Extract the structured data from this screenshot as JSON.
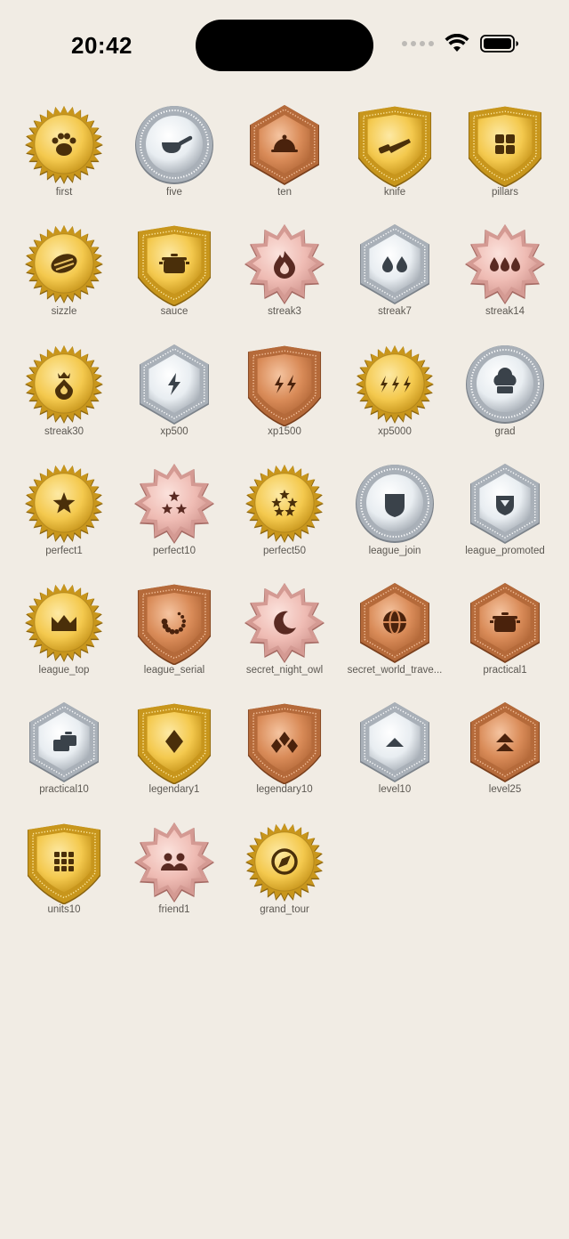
{
  "status_bar": {
    "time": "20:42",
    "icons": [
      "cellular-dots-icon",
      "wifi-icon",
      "battery-icon"
    ]
  },
  "palettes": {
    "gold": {
      "rim": "#c8961c",
      "face": "#f4c94e",
      "light": "#fde9a4",
      "dark": "#8a6410",
      "glyph": "#4a2f0a"
    },
    "silver": {
      "rim": "#a9b0b8",
      "face": "#e8edf1",
      "light": "#ffffff",
      "dark": "#7c838b",
      "glyph": "#3a424a"
    },
    "bronze": {
      "rim": "#b56a3a",
      "face": "#d98b58",
      "light": "#f5c4a0",
      "dark": "#7a3f1c",
      "glyph": "#4a220c"
    },
    "rose": {
      "rim": "#d49a93",
      "face": "#efbcb4",
      "light": "#fbe2dc",
      "dark": "#a56a63",
      "glyph": "#5a2a22"
    }
  },
  "badges": [
    {
      "label": "first",
      "shape": "sun",
      "metal": "gold",
      "icon": "paw-icon"
    },
    {
      "label": "five",
      "shape": "circle",
      "metal": "silver",
      "icon": "pan-icon"
    },
    {
      "label": "ten",
      "shape": "hexagon",
      "metal": "bronze",
      "icon": "cloche-icon"
    },
    {
      "label": "knife",
      "shape": "shield",
      "metal": "gold",
      "icon": "knife-icon"
    },
    {
      "label": "pillars",
      "shape": "shield",
      "metal": "gold",
      "icon": "grid-four-icon"
    },
    {
      "label": "sizzle",
      "shape": "sun",
      "metal": "gold",
      "icon": "sizzle-icon"
    },
    {
      "label": "sauce",
      "shape": "shield",
      "metal": "gold",
      "icon": "pot-icon"
    },
    {
      "label": "streak3",
      "shape": "star",
      "metal": "rose",
      "icon": "flame-icon"
    },
    {
      "label": "streak7",
      "shape": "hexagon",
      "metal": "silver",
      "icon": "double-drop-icon"
    },
    {
      "label": "streak14",
      "shape": "star",
      "metal": "rose",
      "icon": "triple-drop-icon"
    },
    {
      "label": "streak30",
      "shape": "sun",
      "metal": "gold",
      "icon": "crowned-flame-icon"
    },
    {
      "label": "xp500",
      "shape": "hexagon",
      "metal": "silver",
      "icon": "bolt-icon"
    },
    {
      "label": "xp1500",
      "shape": "shield",
      "metal": "bronze",
      "icon": "double-bolt-icon"
    },
    {
      "label": "xp5000",
      "shape": "sun",
      "metal": "gold",
      "icon": "triple-bolt-icon"
    },
    {
      "label": "grad",
      "shape": "circle",
      "metal": "silver",
      "icon": "chef-hat-icon"
    },
    {
      "label": "perfect1",
      "shape": "sun",
      "metal": "gold",
      "icon": "star-icon"
    },
    {
      "label": "perfect10",
      "shape": "star",
      "metal": "rose",
      "icon": "three-stars-icon"
    },
    {
      "label": "perfect50",
      "shape": "sun",
      "metal": "gold",
      "icon": "five-stars-icon"
    },
    {
      "label": "league_join",
      "shape": "circle",
      "metal": "silver",
      "icon": "shield-icon"
    },
    {
      "label": "league_promoted",
      "shape": "hexagon",
      "metal": "silver",
      "icon": "chevron-shield-icon"
    },
    {
      "label": "league_top",
      "shape": "sun",
      "metal": "gold",
      "icon": "crown-icon"
    },
    {
      "label": "league_serial",
      "shape": "shield",
      "metal": "bronze",
      "icon": "loading-ring-icon"
    },
    {
      "label": "secret_night_owl",
      "shape": "star",
      "metal": "rose",
      "icon": "moon-icon"
    },
    {
      "label": "secret_world_trave...",
      "shape": "hexagon",
      "metal": "bronze",
      "icon": "globe-icon"
    },
    {
      "label": "practical1",
      "shape": "hexagon",
      "metal": "bronze",
      "icon": "pot-icon"
    },
    {
      "label": "practical10",
      "shape": "hexagon",
      "metal": "silver",
      "icon": "stacked-pots-icon"
    },
    {
      "label": "legendary1",
      "shape": "shield",
      "metal": "gold",
      "icon": "diamond-icon"
    },
    {
      "label": "legendary10",
      "shape": "shield",
      "metal": "bronze",
      "icon": "three-diamonds-icon"
    },
    {
      "label": "level10",
      "shape": "hexagon",
      "metal": "silver",
      "icon": "chevron-up-icon"
    },
    {
      "label": "level25",
      "shape": "hexagon",
      "metal": "bronze",
      "icon": "double-chevron-up-icon"
    },
    {
      "label": "units10",
      "shape": "shield",
      "metal": "gold",
      "icon": "grid-nine-icon"
    },
    {
      "label": "friend1",
      "shape": "star",
      "metal": "rose",
      "icon": "two-people-icon"
    },
    {
      "label": "grand_tour",
      "shape": "sun",
      "metal": "gold",
      "icon": "compass-icon"
    }
  ]
}
